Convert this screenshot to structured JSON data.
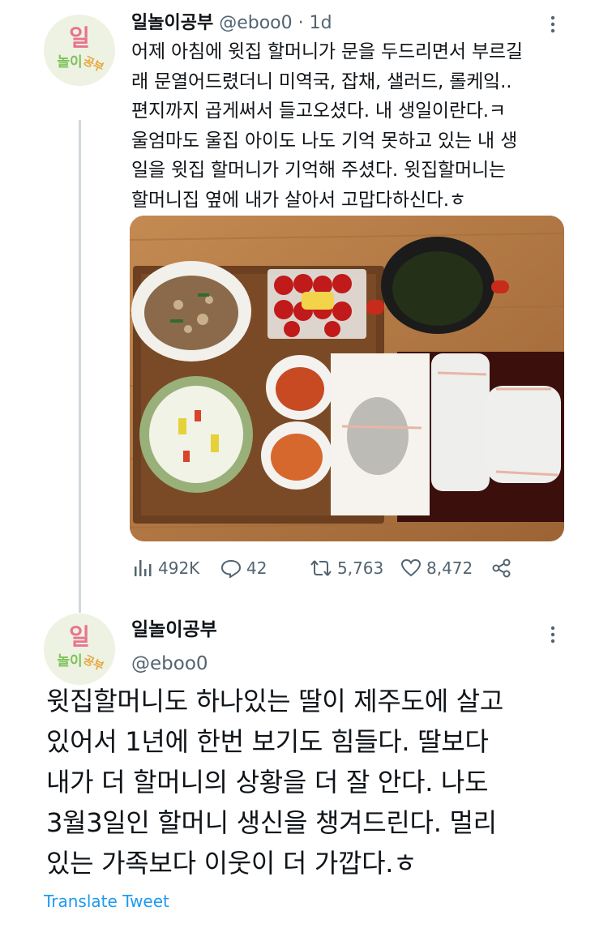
{
  "tweet1": {
    "display_name": "일놀이공부",
    "handle": "@eboo0",
    "separator": "·",
    "time": "1d",
    "text": "어제 아침에 윗집 할머니가 문을 두드리면서 부르길\n래 문열어드렸더니 미역국, 잡채, 샐러드, 롤케잌..\n편지까지 곱게써서 들고오셨다. 내 생일이란다.ㅋ\n울엄마도 울집 아이도 나도 기억 못하고 있는 내 생\n일을 윗집 할머니가 기억해 주셨다. 윗집할머니는\n할머니집 옆에 내가 살아서 고맙다하신다.ㅎ",
    "photo_icon": "photo-food-table",
    "stats": {
      "views": "492K",
      "replies": "42",
      "retweets": "5,763",
      "likes": "8,472"
    }
  },
  "tweet2": {
    "display_name": "일놀이공부",
    "handle": "@eboo0",
    "text": "윗집할머니도 하나있는 딸이 제주도에 살고\n있어서 1년에 한번 보기도 힘들다. 딸보다\n내가 더 할머니의 상황을 더 잘 안다. 나도\n3월3일인 할머니 생신을 챙겨드린다. 멀리\n있는 가족보다 이웃이 더 가깝다.ㅎ",
    "translate_label": "Translate Tweet"
  },
  "avatar_text": {
    "line1": "일",
    "line2": "놀이",
    "line3": "공부"
  },
  "colors": {
    "text": "#0f1419",
    "muted": "#536471",
    "link": "#1d9bf0",
    "thread_line": "#cfd9de"
  }
}
